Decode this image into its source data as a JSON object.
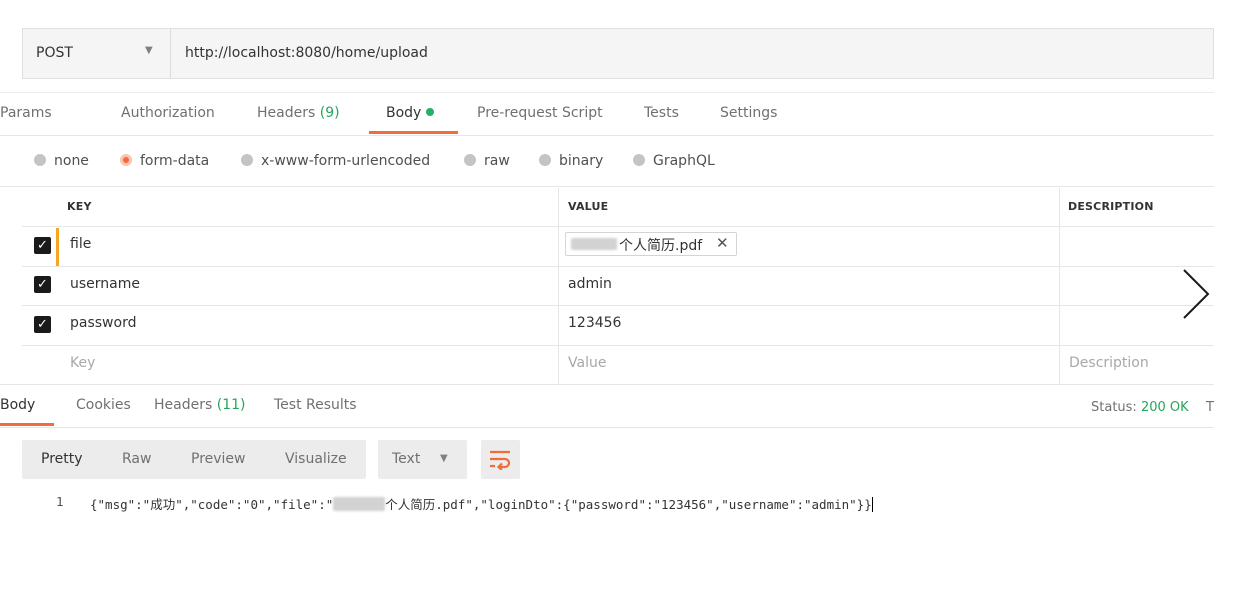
{
  "request": {
    "method": "POST",
    "url": "http://localhost:8080/home/upload"
  },
  "request_tabs": {
    "params": "Params",
    "authorization": "Authorization",
    "headers": "Headers",
    "headers_count": "(9)",
    "body": "Body",
    "pre_request": "Pre-request Script",
    "tests": "Tests",
    "settings": "Settings"
  },
  "body_types": {
    "none": "none",
    "form_data": "form-data",
    "urlencoded": "x-www-form-urlencoded",
    "raw": "raw",
    "binary": "binary",
    "graphql": "GraphQL"
  },
  "table": {
    "col_key": "KEY",
    "col_value": "VALUE",
    "col_description": "DESCRIPTION",
    "rows": [
      {
        "key": "file",
        "value": "个人简历.pdf",
        "checked": true
      },
      {
        "key": "username",
        "value": "admin",
        "checked": true
      },
      {
        "key": "password",
        "value": "123456",
        "checked": true
      }
    ],
    "placeholder_key": "Key",
    "placeholder_value": "Value",
    "placeholder_description": "Description"
  },
  "response_tabs": {
    "body": "Body",
    "cookies": "Cookies",
    "headers": "Headers",
    "headers_count": "(11)",
    "test_results": "Test Results"
  },
  "status": {
    "label": "Status:",
    "value": "200 OK",
    "trailing": "T"
  },
  "view_modes": {
    "pretty": "Pretty",
    "raw": "Raw",
    "preview": "Preview",
    "visualize": "Visualize",
    "format": "Text"
  },
  "response_body": {
    "line_number": "1",
    "part1": "{\"msg\":\"成功\",\"code\":\"0\",\"file\":\"",
    "part2": "个人简历.pdf\",\"loginDto\":{\"password\":\"123456\",\"username\":\"admin\"}}"
  },
  "colors": {
    "accent": "#f26b3a",
    "success": "#26a65b",
    "row_highlight": "#f5a623"
  }
}
